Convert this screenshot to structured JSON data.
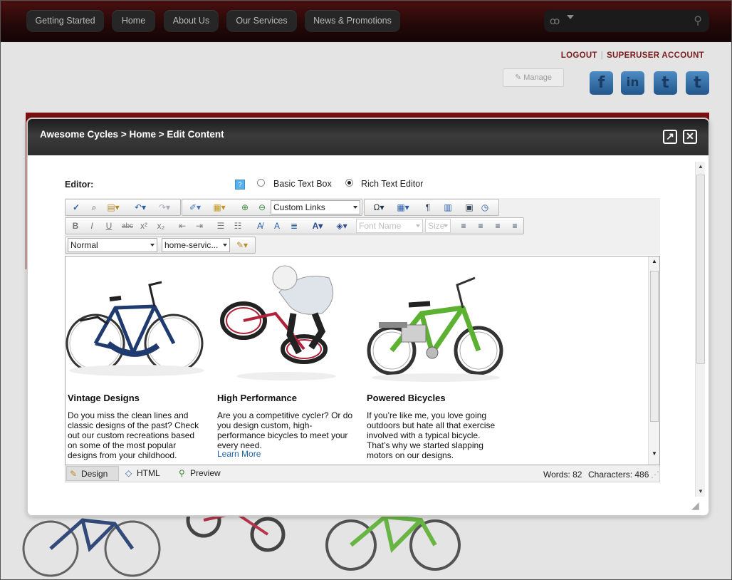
{
  "nav": {
    "items": [
      "Getting Started",
      "Home",
      "About Us",
      "Our Services",
      "News & Promotions"
    ]
  },
  "header": {
    "logout": "LOGOUT",
    "account": "SUPERUSER ACCOUNT",
    "manage": "Manage"
  },
  "social": [
    "facebook-icon",
    "linkedin-icon",
    "twitter-icon",
    "twitter-icon"
  ],
  "modal": {
    "title": "Awesome Cycles > Home > Edit Content",
    "editor_label": "Editor:",
    "radio_basic": "Basic Text Box",
    "radio_rich": "Rich Text Editor",
    "selected": "Rich Text Editor"
  },
  "toolbar": {
    "custom_links": "Custom Links",
    "font_name": "Font Name",
    "size": "Size",
    "paragraph": "Normal",
    "css_class": "home-servic..."
  },
  "content": {
    "columns": [
      {
        "heading": "Vintage Designs",
        "body": "Do you miss the clean lines and classic designs of the past? Check out our custom recreations based on some of the most popular designs from your childhood."
      },
      {
        "heading": "High Performance",
        "body": "Are you a competitive cycler? Or do you design custom, high-performance bicycles to meet your every need.",
        "link": "Learn More"
      },
      {
        "heading": "Powered Bicycles",
        "body": "If you’re like me, you love going outdoors but hate all that exercise involved with a typical bicycle. That’s why we started slapping motors on our designs."
      }
    ]
  },
  "status": {
    "design": "Design",
    "html": "HTML",
    "preview": "Preview",
    "words": "Words: 82",
    "characters": "Characters: 486"
  },
  "colors": {
    "brand_red": "#7a1111",
    "link_blue": "#1a62a8",
    "bike_blue": "#1f3a6e",
    "bike_red": "#b0213a",
    "bike_green": "#5cb132"
  }
}
